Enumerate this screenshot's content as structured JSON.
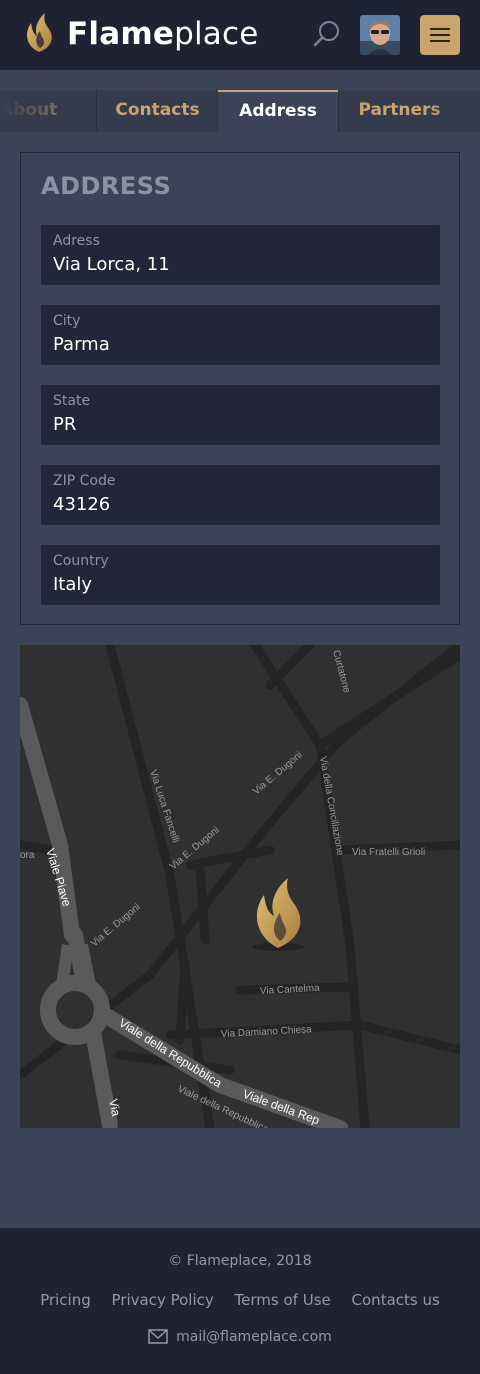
{
  "header": {
    "brand_bold": "Flame",
    "brand_light": "place",
    "icons": [
      "flame-logo",
      "search-icon",
      "user-avatar",
      "hamburger-menu-icon"
    ],
    "accent_color": "#c9a56b"
  },
  "tabs": [
    {
      "label": "About",
      "active": false
    },
    {
      "label": "Contacts",
      "active": false
    },
    {
      "label": "Address",
      "active": true
    },
    {
      "label": "Partners",
      "active": false
    }
  ],
  "address": {
    "title": "ADDRESS",
    "fields": [
      {
        "label": "Adress",
        "value": "Via Lorca, 11"
      },
      {
        "label": "City",
        "value": "Parma"
      },
      {
        "label": "State",
        "value": "PR"
      },
      {
        "label": "ZIP Code",
        "value": "43126"
      },
      {
        "label": "Country",
        "value": "Italy"
      }
    ]
  },
  "map": {
    "streets": [
      "Curtatone",
      "Via E. Dugoni",
      "Via Luca Fancelli",
      "Via della Conciliazione",
      "Via Fratelli Grioli",
      "Viale Piave",
      "Via Cantelma",
      "Via Damiano Chiesa",
      "Viale della Repubblica",
      "Viale della Rep",
      "Viale della Repubblica",
      "ora",
      "Via",
      "Via E. Dugoni",
      "Via E. Dugoni"
    ]
  },
  "footer": {
    "copyright": "© Flameplace, 2018",
    "links": [
      "Pricing",
      "Privacy Policy",
      "Terms of Use",
      "Contacts us"
    ],
    "email": "mail@flameplace.com"
  }
}
